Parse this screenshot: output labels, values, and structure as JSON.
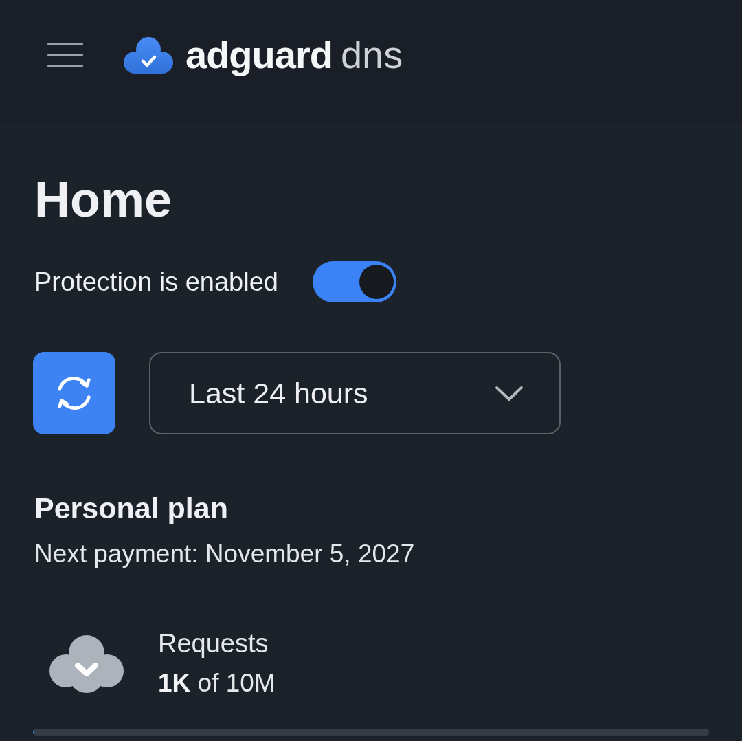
{
  "header": {
    "logo": {
      "brand": "adguard",
      "product": "dns"
    }
  },
  "page": {
    "title": "Home"
  },
  "protection": {
    "label": "Protection is enabled",
    "on": true
  },
  "period": {
    "value": "Last 24 hours"
  },
  "plan": {
    "name": "Personal plan",
    "next_payment": "Next payment: November 5, 2027"
  },
  "usage": [
    {
      "label": "Requests",
      "value": "**1K** of 10M",
      "level": 0.0001
    }
  ]
}
